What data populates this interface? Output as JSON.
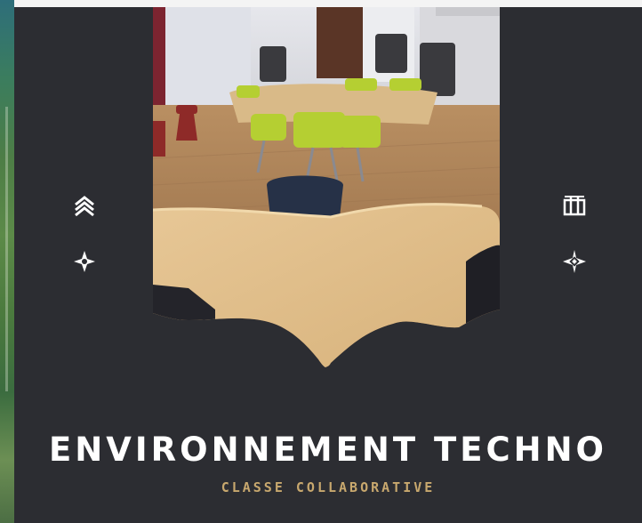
{
  "poster": {
    "title": "ENVIRONNEMENT TECHNO",
    "subtitle": "CLASSE COLLABORATIVE",
    "title_color": "#ffffff",
    "subtitle_color": "#c8a86e",
    "card_color": "#2c2d32"
  },
  "photo": {
    "subject": "collaborative classroom with wooden tables and chairs"
  },
  "icons": {
    "left_top": "chevron-stack-icon",
    "left_bottom": "compass-star-icon",
    "right_top": "columns-icon",
    "right_bottom": "diamond-star-icon"
  }
}
